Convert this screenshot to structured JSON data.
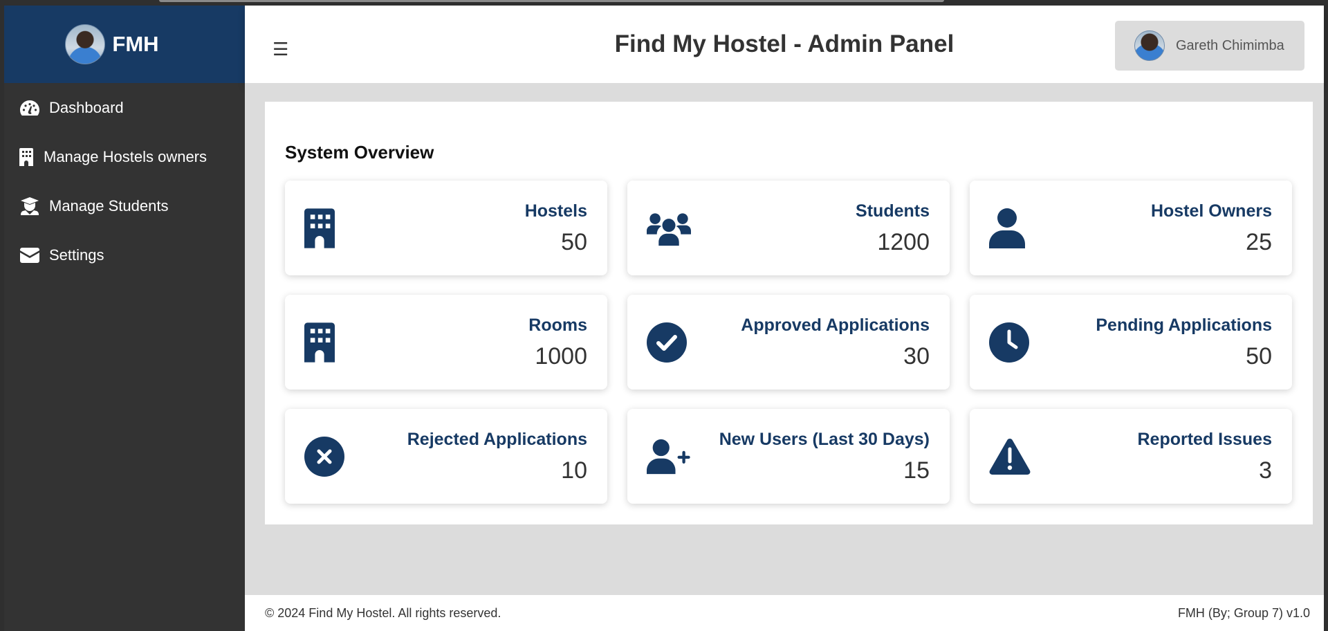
{
  "brand": {
    "name": "FMH"
  },
  "sidebar": {
    "items": [
      {
        "label": "Dashboard",
        "icon": "dashboard-icon"
      },
      {
        "label": "Manage Hostels owners",
        "icon": "building-icon"
      },
      {
        "label": "Manage Students",
        "icon": "student-icon"
      },
      {
        "label": "Settings",
        "icon": "envelope-icon"
      }
    ]
  },
  "header": {
    "menu_toggle": "☰",
    "title": "Find My Hostel - Admin Panel",
    "user_name": "Gareth Chimimba"
  },
  "overview": {
    "title": "System Overview",
    "cards": [
      {
        "title": "Hostels",
        "value": "50",
        "icon": "building-icon"
      },
      {
        "title": "Students",
        "value": "1200",
        "icon": "users-icon"
      },
      {
        "title": "Hostel Owners",
        "value": "25",
        "icon": "user-icon"
      },
      {
        "title": "Rooms",
        "value": "1000",
        "icon": "building-icon"
      },
      {
        "title": "Approved Applications",
        "value": "30",
        "icon": "check-circle-icon"
      },
      {
        "title": "Pending Applications",
        "value": "50",
        "icon": "clock-icon"
      },
      {
        "title": "Rejected Applications",
        "value": "10",
        "icon": "times-circle-icon"
      },
      {
        "title": "New Users (Last 30 Days)",
        "value": "15",
        "icon": "user-plus-icon"
      },
      {
        "title": "Reported Issues",
        "value": "3",
        "icon": "warning-icon"
      }
    ]
  },
  "footer": {
    "copyright": "© 2024 Find My Hostel. All rights reserved.",
    "version": "FMH (By; Group 7) v1.0"
  },
  "colors": {
    "brand_blue": "#173a64",
    "sidebar_bg": "#333333",
    "content_bg": "#dcdcdc"
  }
}
